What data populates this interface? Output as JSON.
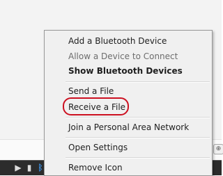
{
  "menu": {
    "items": [
      {
        "label": "Add a Bluetooth Device",
        "state": "normal"
      },
      {
        "label": "Allow a Device to Connect",
        "state": "disabled"
      },
      {
        "label": "Show Bluetooth Devices",
        "state": "default"
      },
      {
        "label": "Send a File",
        "state": "normal"
      },
      {
        "label": "Receive a File",
        "state": "normal"
      },
      {
        "label": "Join a Personal Area Network",
        "state": "normal"
      },
      {
        "label": "Open Settings",
        "state": "normal"
      },
      {
        "label": "Remove Icon",
        "state": "normal"
      }
    ],
    "highlighted_item": "Receive a File",
    "highlight_color": "#cc1020"
  },
  "taskbar": {
    "tray_icons": [
      "speaker-icon",
      "usb-icon",
      "bluetooth-icon"
    ]
  },
  "colors": {
    "menu_background": "#f0f0f0",
    "taskbar_background": "#2c2c2c",
    "bluetooth_icon": "#3a8ad8"
  }
}
